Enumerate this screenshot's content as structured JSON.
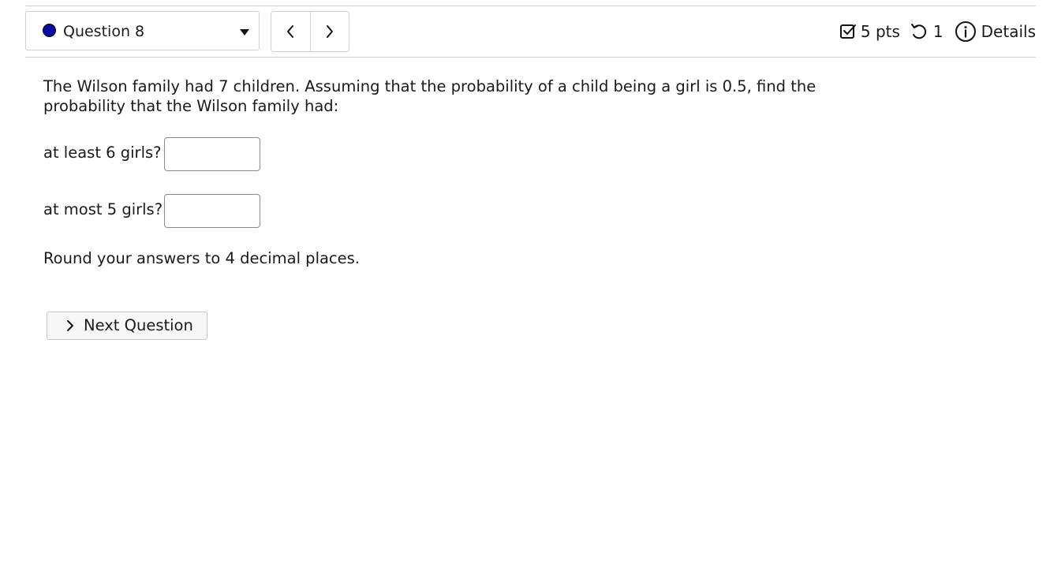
{
  "header": {
    "question_label": "Question 8",
    "points": "5 pts",
    "attempts": "1",
    "details_label": "Details",
    "status_color": "#0a0aa0"
  },
  "question": {
    "prompt": "The Wilson family had 7 children. Assuming that the probability of a child being a girl is 0.5, find the probability that the Wilson family had:",
    "parts": [
      {
        "label": "at least 6 girls?",
        "value": ""
      },
      {
        "label": "at most 5 girls?",
        "value": ""
      }
    ],
    "instruction": "Round your answers to 4 decimal places."
  },
  "footer": {
    "next_label": "Next Question"
  },
  "icons": {
    "status": "filled-circle-icon",
    "dropdown": "caret-down-icon",
    "previous": "chevron-left-icon",
    "next": "chevron-right-icon",
    "points": "checkbox-icon",
    "attempts": "retry-icon",
    "details": "info-icon",
    "next_question": "chevron-right-icon"
  }
}
